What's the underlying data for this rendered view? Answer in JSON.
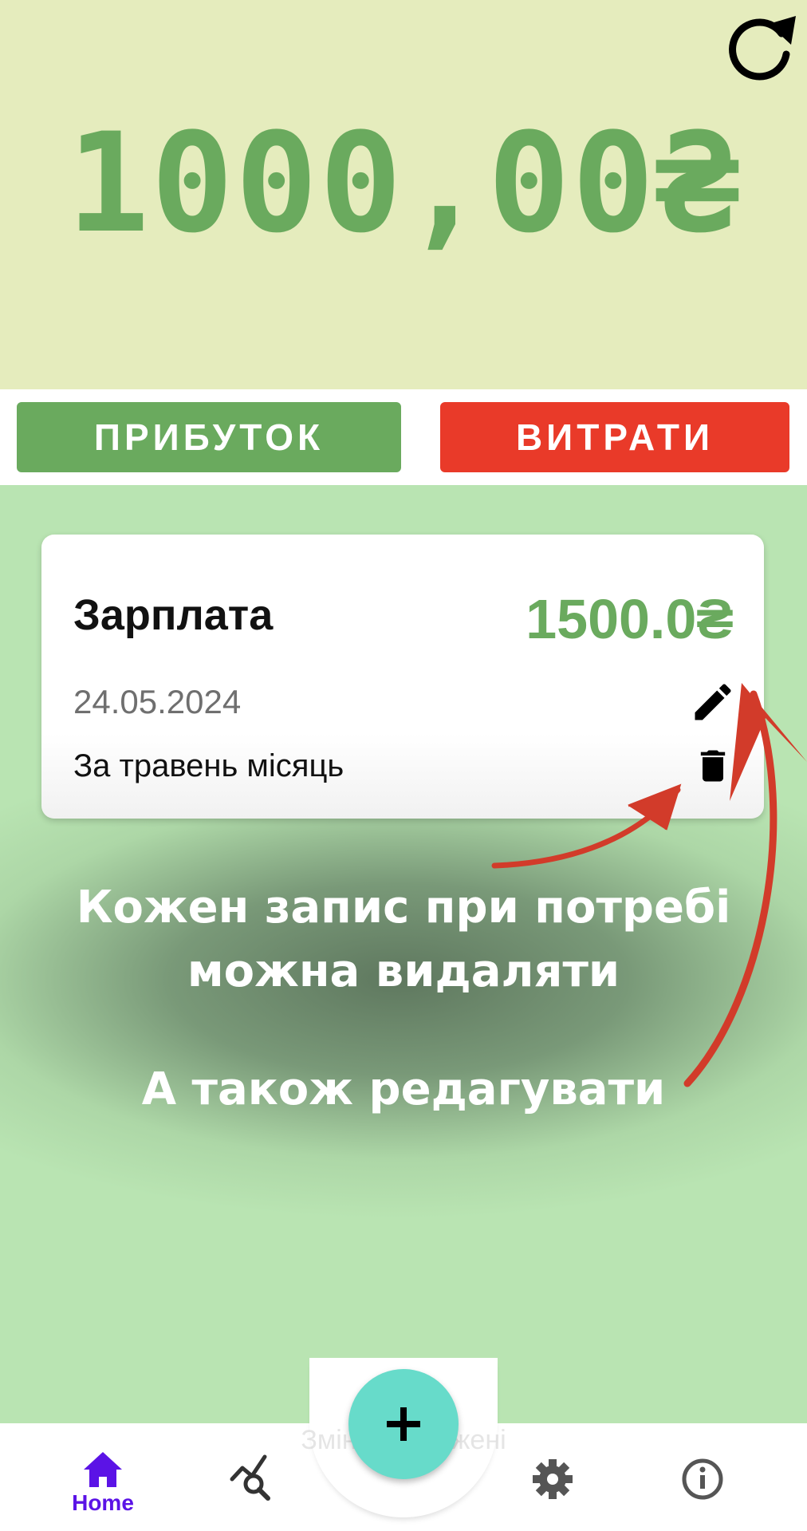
{
  "balance": {
    "amount": "1000,00₴"
  },
  "tabs": {
    "income_label": "ПРИБУТОК",
    "expense_label": "ВИТРАТИ"
  },
  "record": {
    "title": "Зарплата",
    "amount": "1500.0₴",
    "date": "24.05.2024",
    "note": "За травень місяць"
  },
  "captions": {
    "delete_hint": "Кожен запис при потребі можна видаляти",
    "edit_hint": "А також редагувати"
  },
  "toast": "Зміни збережені",
  "nav": {
    "home_label": "Home"
  },
  "colors": {
    "accent_green": "#6aaa5e",
    "expense_red": "#e93a29",
    "nav_active": "#5b13e6",
    "fab": "#67dbca",
    "arrow": "#d23b2a"
  },
  "icons": [
    "refresh-icon",
    "edit-icon",
    "delete-icon",
    "plus-icon",
    "home-icon",
    "stats-icon",
    "settings-icon",
    "info-icon"
  ]
}
